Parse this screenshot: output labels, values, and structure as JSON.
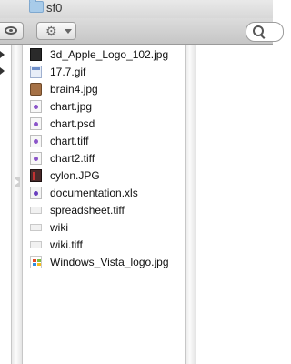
{
  "window": {
    "title": "sf0"
  },
  "toolbar": {
    "view_button": "eye-icon",
    "action_button": "gear-icon",
    "search": "search-icon"
  },
  "files": [
    {
      "name": "3d_Apple_Logo_102.jpg",
      "icon": "dark-image-thumbnail"
    },
    {
      "name": "17.7.gif",
      "icon": "gif-icon"
    },
    {
      "name": "brain4.jpg",
      "icon": "image-thumbnail"
    },
    {
      "name": "chart.jpg",
      "icon": "preview-document-icon"
    },
    {
      "name": "chart.psd",
      "icon": "preview-document-icon"
    },
    {
      "name": "chart.tiff",
      "icon": "preview-document-icon"
    },
    {
      "name": "chart2.tiff",
      "icon": "preview-document-icon"
    },
    {
      "name": "cylon.JPG",
      "icon": "image-thumbnail"
    },
    {
      "name": "documentation.xls",
      "icon": "spreadsheet-icon"
    },
    {
      "name": "spreadsheet.tiff",
      "icon": "blank-document-icon"
    },
    {
      "name": "wiki",
      "icon": "blank-document-icon"
    },
    {
      "name": "wiki.tiff",
      "icon": "blank-document-icon"
    },
    {
      "name": "Windows_Vista_logo.jpg",
      "icon": "windows-logo-thumbnail"
    }
  ]
}
